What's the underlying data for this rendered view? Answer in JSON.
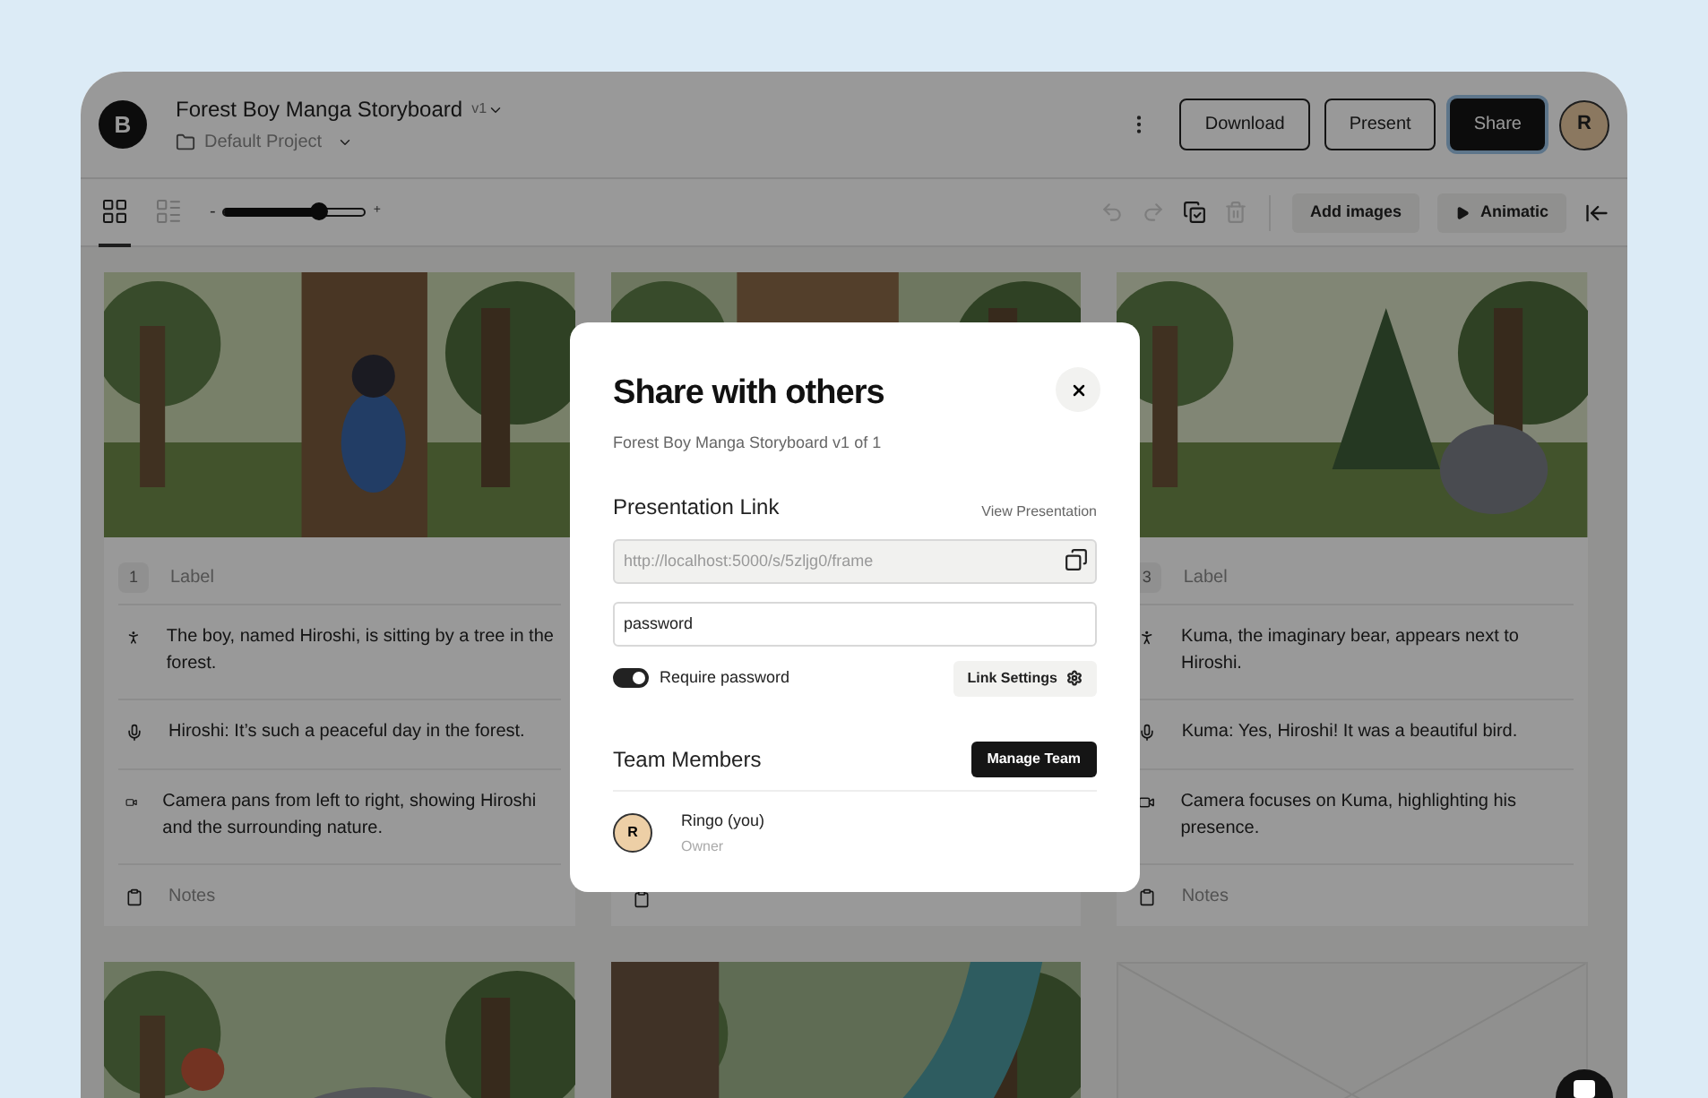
{
  "header": {
    "logo": "B",
    "title": "Forest Boy Manga Storyboard",
    "version": "v1",
    "project": "Default Project",
    "buttons": [
      {
        "label": "Download",
        "kind": "outline"
      },
      {
        "label": "Present",
        "kind": "outline"
      },
      {
        "label": "Share",
        "kind": "primary"
      }
    ],
    "avatar": "R"
  },
  "toolbar": {
    "views": [
      {
        "kind": "grid",
        "selected": true
      },
      {
        "kind": "list",
        "selected": false
      }
    ],
    "zoom": {
      "minus": "-",
      "plus": "+",
      "level": 0.68
    },
    "actions": [
      {
        "kind": "undo",
        "disabled": true
      },
      {
        "kind": "redo",
        "disabled": true
      },
      {
        "kind": "select",
        "disabled": false
      },
      {
        "kind": "delete",
        "disabled": true
      }
    ],
    "buttons": [
      {
        "label": "Add images",
        "kind": "plain"
      },
      {
        "label": "Animatic",
        "kind": "play"
      }
    ]
  },
  "frames": [
    {
      "kind": "picture",
      "number": "1",
      "label_placeholder": "Label",
      "rows": [
        {
          "kind": "action",
          "text": "The boy, named Hiroshi, is sitting by a tree in the forest."
        },
        {
          "kind": "dialogue",
          "text": "Hiroshi: It’s such a peaceful day in the forest."
        },
        {
          "kind": "camera",
          "text": "Camera pans from left to right, showing Hiroshi and the surrounding nature."
        },
        {
          "kind": "notes",
          "placeholder": "Notes"
        }
      ]
    },
    {
      "kind": "picture",
      "rows": [
        {
          "kind": "notes"
        }
      ]
    },
    {
      "kind": "picture",
      "number": "3",
      "label_placeholder": "Label",
      "rows": [
        {
          "kind": "action",
          "text": "Kuma, the imaginary bear, appears next to Hiroshi."
        },
        {
          "kind": "dialogue",
          "text": "Kuma: Yes, Hiroshi! It was a beautiful bird."
        },
        {
          "kind": "camera",
          "text": "Camera focuses on Kuma, highlighting his presence."
        },
        {
          "kind": "notes",
          "placeholder": "Notes"
        }
      ]
    },
    {
      "kind": "picture"
    },
    {
      "kind": "picture"
    },
    {
      "kind": "empty"
    }
  ],
  "dialog": {
    "title": "Share with others",
    "subtitle": "Forest Boy Manga Storyboard v1 of 1",
    "link_heading": "Presentation Link",
    "view_link": "View Presentation",
    "url_placeholder": "http://localhost:5000/s/5zljg0/frame",
    "password": "password",
    "require_password": {
      "label": "Require password",
      "on": true
    },
    "link_settings": "Link Settings",
    "team_heading": "Team Members",
    "manage_team": "Manage Team",
    "members": [
      {
        "initial": "R",
        "name": "Ringo (you)",
        "role": "Owner"
      }
    ]
  }
}
